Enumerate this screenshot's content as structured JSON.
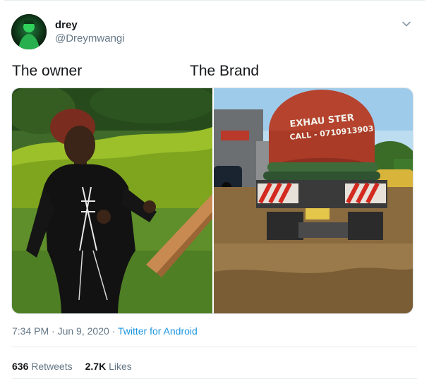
{
  "tweet": {
    "author": {
      "display_name": "drey",
      "handle": "@Dreymwangi"
    },
    "captions": {
      "left": "The owner",
      "right": "The Brand"
    },
    "media": {
      "truck_text": {
        "line1": "EXHAU STER",
        "line2": "CALL - 0710913903"
      }
    },
    "meta": {
      "time": "7:34 PM",
      "separator": "·",
      "date": "Jun 9, 2020",
      "source": "Twitter for Android"
    },
    "stats": {
      "retweets_count": "636",
      "retweets_label": "Retweets",
      "likes_count": "2.7K",
      "likes_label": "Likes"
    }
  },
  "icons": {
    "menu": "chevron-down-icon",
    "avatar": "avatar-image"
  },
  "colors": {
    "link_blue": "#1b95e0",
    "secondary_text": "#657786",
    "border": "#e6ecf0"
  }
}
